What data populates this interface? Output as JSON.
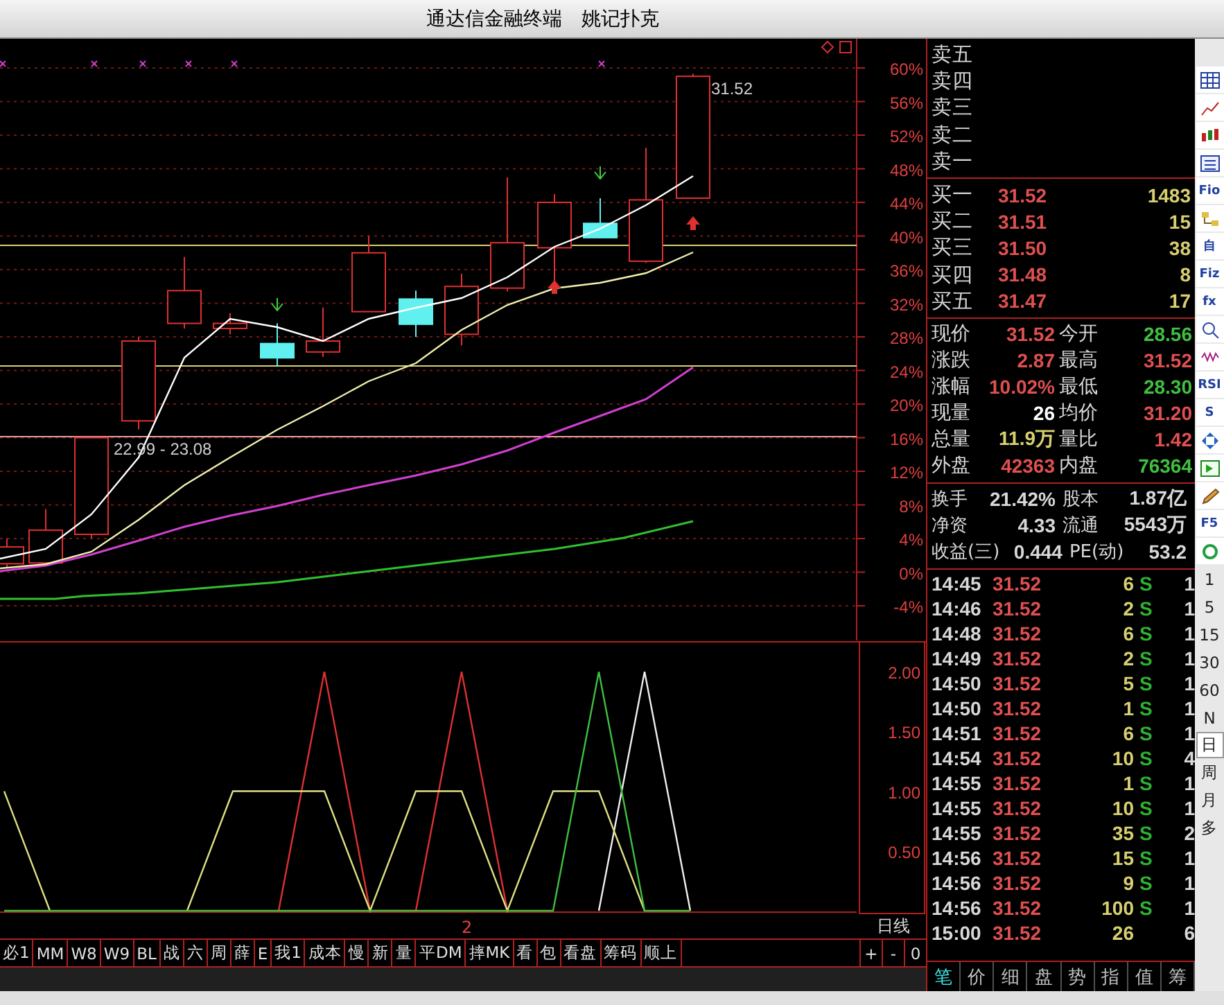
{
  "window": {
    "title": "通达信金融终端　姚记扑克"
  },
  "price_chart": {
    "axis_labels": [
      "60%",
      "56%",
      "52%",
      "48%",
      "44%",
      "40%",
      "36%",
      "32%",
      "28%",
      "24%",
      "20%",
      "16%",
      "12%",
      "8%",
      "4%",
      "0%",
      "-4%"
    ],
    "last_price_label": "31.52",
    "range_label": "22.99 - 23.08"
  },
  "indicator_chart": {
    "chart_data": {
      "type": "line",
      "categories": [
        null,
        null,
        null,
        null,
        null,
        null,
        null,
        null,
        null,
        null,
        null,
        null,
        null,
        null,
        null,
        null
      ],
      "ylim": [
        0,
        2.25
      ],
      "yticks": [
        {
          "value": 0.5,
          "label": "0.50"
        },
        {
          "value": 1,
          "label": "1.00"
        },
        {
          "value": 1.5,
          "label": "1.50"
        },
        {
          "value": 2,
          "label": "2.00"
        }
      ],
      "series": [
        {
          "color": "#40c040",
          "values": [
            0,
            0,
            0,
            0,
            0,
            0,
            0,
            0,
            0,
            0,
            0,
            0,
            0,
            2,
            0,
            0
          ]
        },
        {
          "color": "#e0e080",
          "values": [
            1,
            0,
            null,
            null,
            0,
            1,
            1,
            1,
            0,
            1,
            1,
            0,
            1,
            1,
            0,
            null
          ]
        },
        {
          "color": "#e03030",
          "values": [
            null,
            null,
            null,
            null,
            null,
            null,
            0,
            2,
            0,
            0,
            2,
            0,
            null,
            null,
            null,
            null
          ]
        },
        {
          "color": "#f0f0f0",
          "values": [
            null,
            null,
            null,
            null,
            null,
            null,
            null,
            null,
            null,
            null,
            null,
            null,
            null,
            0,
            2,
            0
          ]
        }
      ]
    }
  },
  "period_marker": "2",
  "period_label": "日线",
  "formula_buttons": [
    "必1",
    "MM",
    "W8",
    "W9",
    "BL",
    "战",
    "六",
    "周",
    "薛",
    "E",
    "我1",
    "成本",
    "慢",
    "新",
    "量",
    "平DM",
    "摔MK",
    "看",
    "包",
    "看盘",
    "筹码",
    "顺上"
  ],
  "zoom_buttons": [
    "+",
    "-",
    "0"
  ],
  "order_book": {
    "sell": [
      {
        "label": "卖五"
      },
      {
        "label": "卖四"
      },
      {
        "label": "卖三"
      },
      {
        "label": "卖二"
      },
      {
        "label": "卖一"
      }
    ],
    "buy": [
      {
        "label": "买一",
        "price": "31.52",
        "volume": "1483"
      },
      {
        "label": "买二",
        "price": "31.51",
        "volume": "15"
      },
      {
        "label": "买三",
        "price": "31.50",
        "volume": "38"
      },
      {
        "label": "买四",
        "price": "31.48",
        "volume": "8"
      },
      {
        "label": "买五",
        "price": "31.47",
        "volume": "17"
      }
    ]
  },
  "quote": [
    {
      "label": "现价",
      "value": "31.52",
      "color": "#e05050"
    },
    {
      "label": "今开",
      "value": "28.56",
      "color": "#40c040"
    },
    {
      "label": "涨跌",
      "value": "2.87",
      "color": "#e05050"
    },
    {
      "label": "最高",
      "value": "31.52",
      "color": "#e05050"
    },
    {
      "label": "涨幅",
      "value": "10.02%",
      "color": "#e05050"
    },
    {
      "label": "最低",
      "value": "28.30",
      "color": "#40c040"
    },
    {
      "label": "现量",
      "value": "26",
      "color": "#ffffff"
    },
    {
      "label": "均价",
      "value": "31.20",
      "color": "#e05050"
    },
    {
      "label": "总量",
      "value": "11.9万",
      "color": "#d8d070"
    },
    {
      "label": "量比",
      "value": "1.42",
      "color": "#e05050"
    },
    {
      "label": "外盘",
      "value": "42363",
      "color": "#e05050"
    },
    {
      "label": "内盘",
      "value": "76364",
      "color": "#40c040"
    }
  ],
  "stats": [
    {
      "label": "换手",
      "value": "21.42%"
    },
    {
      "label": "股本",
      "value": "1.87亿"
    },
    {
      "label": "净资",
      "value": "4.33"
    },
    {
      "label": "流通",
      "value": "5543万"
    },
    {
      "label": "收益(三)",
      "value": "0.444"
    },
    {
      "label": "PE(动)",
      "value": "53.2"
    }
  ],
  "ticks": [
    {
      "time": "14:45",
      "price": "31.52",
      "volume": "6",
      "side": "S",
      "count": "1"
    },
    {
      "time": "14:46",
      "price": "31.52",
      "volume": "2",
      "side": "S",
      "count": "1"
    },
    {
      "time": "14:48",
      "price": "31.52",
      "volume": "6",
      "side": "S",
      "count": "1"
    },
    {
      "time": "14:49",
      "price": "31.52",
      "volume": "2",
      "side": "S",
      "count": "1"
    },
    {
      "time": "14:50",
      "price": "31.52",
      "volume": "5",
      "side": "S",
      "count": "1"
    },
    {
      "time": "14:50",
      "price": "31.52",
      "volume": "1",
      "side": "S",
      "count": "1"
    },
    {
      "time": "14:51",
      "price": "31.52",
      "volume": "6",
      "side": "S",
      "count": "1"
    },
    {
      "time": "14:54",
      "price": "31.52",
      "volume": "10",
      "side": "S",
      "count": "4"
    },
    {
      "time": "14:55",
      "price": "31.52",
      "volume": "1",
      "side": "S",
      "count": "1"
    },
    {
      "time": "14:55",
      "price": "31.52",
      "volume": "10",
      "side": "S",
      "count": "1"
    },
    {
      "time": "14:55",
      "price": "31.52",
      "volume": "35",
      "side": "S",
      "count": "2"
    },
    {
      "time": "14:56",
      "price": "31.52",
      "volume": "15",
      "side": "S",
      "count": "1"
    },
    {
      "time": "14:56",
      "price": "31.52",
      "volume": "9",
      "side": "S",
      "count": "1"
    },
    {
      "time": "14:56",
      "price": "31.52",
      "volume": "100",
      "side": "S",
      "count": "1"
    },
    {
      "time": "15:00",
      "price": "31.52",
      "volume": "26",
      "count": "6"
    }
  ],
  "tabs": [
    {
      "label": "笔",
      "selected": true
    },
    {
      "label": "价",
      "selected": false
    },
    {
      "label": "细",
      "selected": false
    },
    {
      "label": "盘",
      "selected": false
    },
    {
      "label": "势",
      "selected": false
    },
    {
      "label": "指",
      "selected": false
    },
    {
      "label": "值",
      "selected": false
    },
    {
      "label": "筹",
      "selected": false
    }
  ],
  "toolbar": {
    "icons": [
      {
        "kind": "grid"
      },
      {
        "kind": "line"
      },
      {
        "kind": "candles"
      },
      {
        "kind": "list"
      },
      {
        "kind": "text",
        "label": "Fio"
      },
      {
        "kind": "tree"
      },
      {
        "kind": "text",
        "label": "自"
      },
      {
        "kind": "text",
        "label": "Fiz"
      },
      {
        "kind": "text",
        "label": "fx"
      },
      {
        "kind": "search"
      },
      {
        "kind": "wave"
      },
      {
        "kind": "text",
        "label": "RSI"
      },
      {
        "kind": "text",
        "label": "S"
      },
      {
        "kind": "move"
      },
      {
        "kind": "arrow"
      },
      {
        "kind": "pencil"
      },
      {
        "kind": "text",
        "label": "F5"
      },
      {
        "kind": "refresh"
      }
    ],
    "periods": [
      {
        "label": "1",
        "selected": false
      },
      {
        "label": "5",
        "selected": false
      },
      {
        "label": "15",
        "selected": false
      },
      {
        "label": "30",
        "selected": false
      },
      {
        "label": "60",
        "selected": false
      },
      {
        "label": "N",
        "selected": false
      },
      {
        "label": "日",
        "selected": true
      },
      {
        "label": "周",
        "selected": false
      },
      {
        "label": "月",
        "selected": false
      },
      {
        "label": "多",
        "selected": false
      }
    ]
  }
}
